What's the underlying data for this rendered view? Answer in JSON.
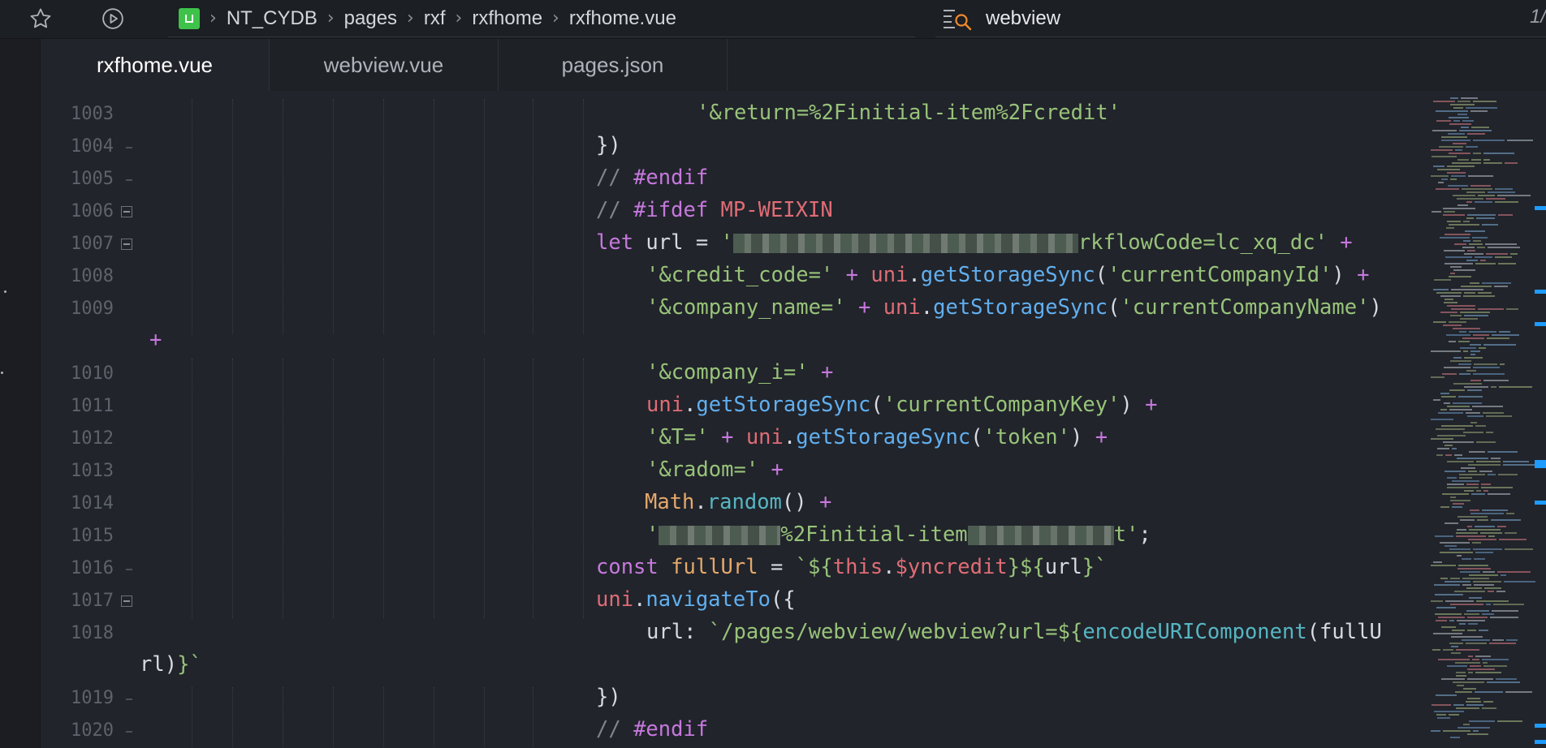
{
  "breadcrumb": [
    "NT_CYDB",
    "pages",
    "rxf",
    "rxfhome",
    "rxfhome.vue"
  ],
  "search": {
    "query": "webview",
    "count": "1/"
  },
  "tabs": [
    "rxfhome.vue",
    "webview.vue",
    "pages.json"
  ],
  "active_tab": 0,
  "line_numbers": [
    "1003",
    "1004",
    "1005",
    "1006",
    "1007",
    "1008",
    "1009",
    "1010",
    "1011",
    "1012",
    "1013",
    "1014",
    "1015",
    "1016",
    "1017",
    "1018",
    "1019",
    "1020"
  ],
  "code": {
    "l1003": "'&return=%2Finitial-item%2Fcredit'",
    "l1004": "})",
    "l1005_comment": "// ",
    "l1005_dir": "#endif",
    "l1006_comment": "// ",
    "l1006_dir": "#ifdef ",
    "l1006_macro": "MP-WEIXIN",
    "l1007_kw": "let",
    "l1007_var": " url = ",
    "l1007_str_a": "'",
    "l1007_str_b": "rkflowCode=lc_xq_dc'",
    "l1007_op": " +",
    "l1008_str": "'&credit_code='",
    "l1008_op": " + ",
    "l1008_obj": "uni",
    "l1008_dot": ".",
    "l1008_fn": "getStorageSync",
    "l1008_p1": "(",
    "l1008_arg": "'currentCompanyId'",
    "l1008_p2": ")",
    "l1008_op2": " +",
    "l1009_str": "'&company_name='",
    "l1009_op": " + ",
    "l1009_obj": "uni",
    "l1009_dot": ".",
    "l1009_fn": "getStorageSync",
    "l1009_p1": "(",
    "l1009_arg": "'currentCompanyName'",
    "l1009_p2": ")",
    "l1009_wrap_op": "+",
    "l1010_str": "'&company_i='",
    "l1010_op": " +",
    "l1011_obj": "uni",
    "l1011_dot": ".",
    "l1011_fn": "getStorageSync",
    "l1011_p1": "(",
    "l1011_arg": "'currentCompanyKey'",
    "l1011_p2": ")",
    "l1011_op": " +",
    "l1012_str": "'&T='",
    "l1012_op": " + ",
    "l1012_obj": "uni",
    "l1012_dot": ".",
    "l1012_fn": "getStorageSync",
    "l1012_p1": "(",
    "l1012_arg": "'token'",
    "l1012_p2": ")",
    "l1012_op2": " +",
    "l1013_str": "'&radom='",
    "l1013_op": " +",
    "l1014_cls": "Math",
    "l1014_dot": ".",
    "l1014_fn": "random",
    "l1014_p": "()",
    "l1014_op": " +",
    "l1015_str_a": "'",
    "l1015_str_b": "%2Finitial-item",
    "l1015_str_c": "t'",
    "l1015_end": ";",
    "l1016_kw": "const",
    "l1016_var": " fullUrl",
    "l1016_eq": " = ",
    "l1016_t1": "`${",
    "l1016_this": "this",
    "l1016_dot": ".",
    "l1016_prop": "$yncredit",
    "l1016_t2": "}${",
    "l1016_url": "url",
    "l1016_t3": "}`",
    "l1017_obj": "uni",
    "l1017_dot": ".",
    "l1017_fn": "navigateTo",
    "l1017_p": "({",
    "l1018_key": "url",
    "l1018_colon": ": ",
    "l1018_tpl": "`/pages/webview/webview?url=${",
    "l1018_fn": "encodeURIComponent",
    "l1018_p": "(fullU",
    "l1018_wrap_a": "rl)",
    "l1018_wrap_b": "}`",
    "l1019": "})",
    "l1020_comment": "// ",
    "l1020_dir": "#endif"
  },
  "colors": {
    "background": "#21242b",
    "keyword": "#c678dd",
    "string": "#98c379",
    "function": "#61afef",
    "object": "#e06c75",
    "class": "#e5c07b",
    "project_badge": "#3ec24a",
    "minimap_marker": "#1e9bff"
  },
  "icons": {
    "toolbar": [
      "star-icon",
      "run-icon"
    ],
    "project": "project-icon",
    "search": "search-results-icon"
  }
}
